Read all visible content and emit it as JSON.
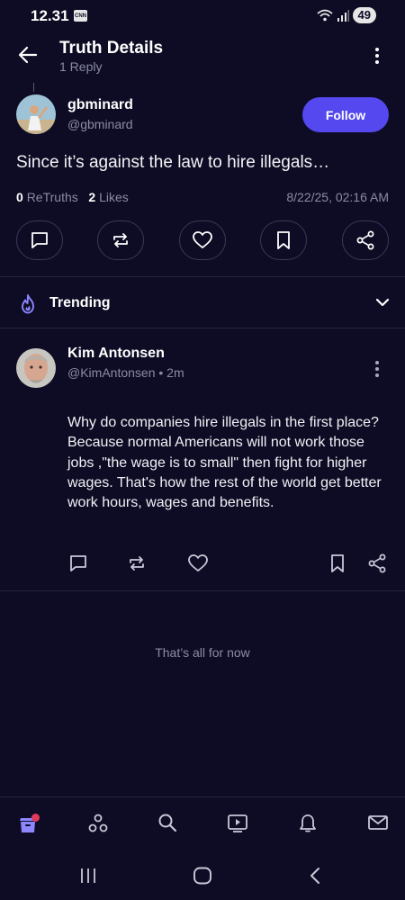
{
  "status_bar": {
    "time": "12.31",
    "app_badge": "CNN",
    "battery": "49"
  },
  "header": {
    "title": "Truth Details",
    "subtitle": "1 Reply"
  },
  "post": {
    "author_name": "gbminard",
    "author_handle": "@gbminard",
    "follow_label": "Follow",
    "text": "Since it’s against the law to hire illegals…",
    "retruths_count": "0",
    "retruths_label": "ReTruths",
    "likes_count": "2",
    "likes_label": "Likes",
    "date": "8/22/25, 02:16 AM",
    "actions": [
      "reply-icon",
      "retruth-icon",
      "like-icon",
      "bookmark-icon",
      "share-icon"
    ]
  },
  "trending": {
    "label": "Trending"
  },
  "reply": {
    "author_name": "Kim Antonsen",
    "author_handle": "@KimAntonsen",
    "separator": "•",
    "time_ago": "2m",
    "text": "Why do companies hire illegals in the first place? Because normal Americans will not work those jobs ,\"the wage is to small\" then fight for higher wages. That's how the rest of the world get better work hours, wages and benefits."
  },
  "end_message": "That’s all for now",
  "bottom_nav": {
    "items": [
      "home-icon",
      "groups-icon",
      "search-icon",
      "video-icon",
      "notifications-icon",
      "messages-icon"
    ],
    "active": "home-icon"
  },
  "colors": {
    "background": "#0d0c24",
    "accent": "#5448ee",
    "muted_text": "#8c8ba5",
    "notification_dot": "#e03a5b"
  }
}
